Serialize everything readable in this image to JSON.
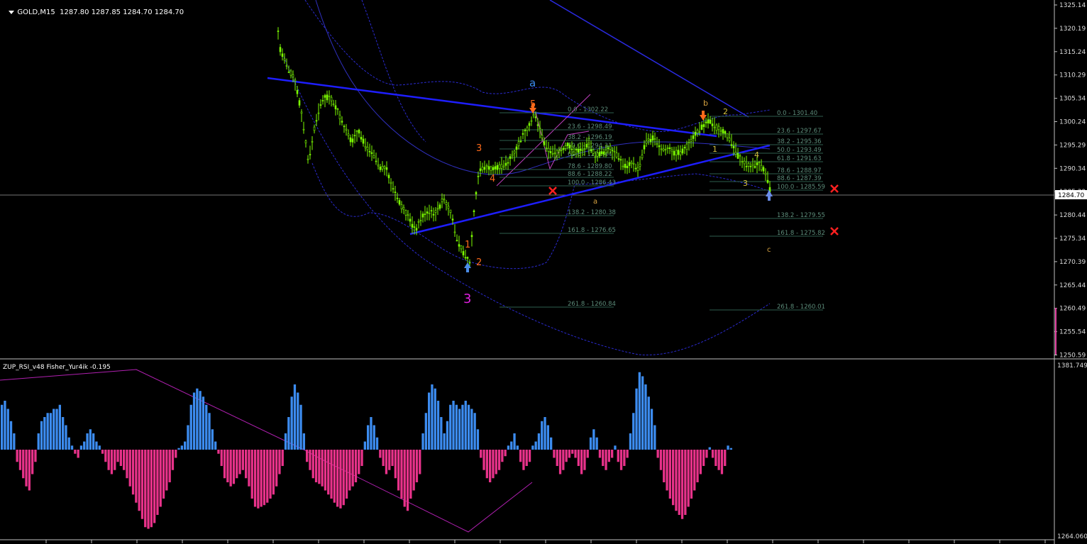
{
  "main_chart": {
    "symbol_label": "GOLD,M15",
    "ohlc": "1287.80 1287.85 1284.70 1284.70",
    "price_axis": [
      "1325.14",
      "1320.19",
      "1315.24",
      "1310.29",
      "1305.34",
      "1300.24",
      "1295.29",
      "1290.34",
      "1285.39",
      "1280.44",
      "1275.34",
      "1270.39",
      "1265.44",
      "1260.49",
      "1255.54",
      "1250.59"
    ],
    "current_price_tag": "1284.70",
    "fib_set_1": [
      "0.0 - 1302.22",
      "23.6 - 1298.49",
      "38.2 - 1296.19",
      "50.0 - 1294.31",
      "61.8 - 1292.44",
      "78.6 - 1289.80",
      "88.6 - 1288.22",
      "100.0 - 1286.43",
      "138.2 - 1280.38",
      "161.8 - 1276.65",
      "261.8 - 1260.84"
    ],
    "fib_set_2": [
      "0.0 - 1301.40",
      "23.6 - 1297.67",
      "38.2 - 1295.36",
      "50.0 - 1293.49",
      "61.8 - 1291.63",
      "78.6 - 1288.97",
      "88.6 - 1287.39",
      "100.0 - 1285.59",
      "138.2 - 1279.55",
      "161.8 - 1275.82",
      "261.8 - 1260.01"
    ],
    "wave_labels": {
      "a_top": "a",
      "five": "5",
      "three_small": "3",
      "four": "4",
      "one": "1",
      "two": "2",
      "three_big": "3",
      "a_small": "a",
      "b": "b",
      "two_right": "2",
      "one_right": "1",
      "four_right": "4",
      "three_right": "3",
      "c": "c"
    }
  },
  "indicator": {
    "title": "ZUP_RSI_v48  Fisher_Yur4ik -0.195",
    "axis_top": "1381.749",
    "axis_bottom": "1264.060",
    "histogram_values": [
      0.55,
      0.6,
      0.5,
      0.35,
      0.2,
      -0.15,
      -0.25,
      -0.35,
      -0.45,
      -0.5,
      -0.3,
      -0.15,
      0.2,
      0.35,
      0.4,
      0.45,
      0.45,
      0.5,
      0.5,
      0.55,
      0.4,
      0.3,
      0.15,
      0.05,
      -0.05,
      -0.1,
      0.05,
      0.1,
      0.2,
      0.25,
      0.2,
      0.1,
      0.05,
      -0.05,
      -0.15,
      -0.25,
      -0.3,
      -0.25,
      -0.15,
      -0.2,
      -0.25,
      -0.35,
      -0.45,
      -0.55,
      -0.65,
      -0.75,
      -0.85,
      -0.95,
      -0.97,
      -0.95,
      -0.9,
      -0.8,
      -0.7,
      -0.6,
      -0.5,
      -0.4,
      -0.25,
      -0.1,
      0.02,
      0.05,
      0.1,
      0.3,
      0.55,
      0.7,
      0.75,
      0.72,
      0.65,
      0.55,
      0.45,
      0.25,
      0.1,
      -0.05,
      -0.2,
      -0.35,
      -0.4,
      -0.45,
      -0.42,
      -0.35,
      -0.3,
      -0.25,
      -0.35,
      -0.45,
      -0.6,
      -0.7,
      -0.72,
      -0.7,
      -0.68,
      -0.65,
      -0.6,
      -0.55,
      -0.45,
      -0.3,
      -0.2,
      0.2,
      0.4,
      0.65,
      0.8,
      0.7,
      0.55,
      0.2,
      -0.15,
      -0.25,
      -0.35,
      -0.4,
      -0.42,
      -0.45,
      -0.5,
      -0.55,
      -0.6,
      -0.65,
      -0.7,
      -0.72,
      -0.68,
      -0.6,
      -0.5,
      -0.45,
      -0.4,
      -0.3,
      -0.2,
      0.1,
      0.3,
      0.4,
      0.3,
      0.15,
      -0.1,
      -0.2,
      -0.3,
      -0.25,
      -0.2,
      -0.35,
      -0.5,
      -0.6,
      -0.7,
      -0.75,
      -0.6,
      -0.5,
      -0.4,
      -0.3,
      0.2,
      0.45,
      0.7,
      0.8,
      0.75,
      0.6,
      0.4,
      0.2,
      0.35,
      0.55,
      0.6,
      0.55,
      0.5,
      0.55,
      0.6,
      0.55,
      0.5,
      0.45,
      0.25,
      -0.1,
      -0.25,
      -0.35,
      -0.4,
      -0.35,
      -0.3,
      -0.25,
      -0.15,
      -0.08,
      0.05,
      0.1,
      0.2,
      0.05,
      -0.15,
      -0.25,
      -0.2,
      -0.15,
      0.05,
      0.1,
      0.2,
      0.35,
      0.4,
      0.3,
      0.15,
      -0.1,
      -0.2,
      -0.3,
      -0.25,
      -0.15,
      -0.1,
      -0.05,
      -0.1,
      -0.2,
      -0.3,
      -0.25,
      -0.1,
      0.15,
      0.25,
      0.15,
      -0.1,
      -0.2,
      -0.25,
      -0.15,
      -0.1,
      0.05,
      -0.15,
      -0.25,
      -0.2,
      -0.1,
      0.2,
      0.45,
      0.75,
      0.95,
      0.9,
      0.8,
      0.65,
      0.5,
      0.3,
      -0.1,
      -0.25,
      -0.4,
      -0.5,
      -0.6,
      -0.68,
      -0.75,
      -0.8,
      -0.85,
      -0.8,
      -0.7,
      -0.6,
      -0.5,
      -0.4,
      -0.3,
      -0.2,
      -0.1,
      0.03,
      -0.1,
      -0.2,
      -0.25,
      -0.3,
      -0.2,
      0.05,
      0.02
    ]
  },
  "colors": {
    "background": "#000000",
    "candle_up": "#7CFC00",
    "trendline": "#1E1EFF",
    "bollinger": "#2A2AD0",
    "histogram_positive": "#3C8CF0",
    "histogram_negative": "#E8328A",
    "zigzag": "#B020B0",
    "fib_line": "#2E5E4E",
    "fib_text": "#5C8C7A",
    "cross_marker": "#FF2020",
    "arrow_up": "#4A8CE8",
    "arrow_down": "#FF6A1A"
  }
}
